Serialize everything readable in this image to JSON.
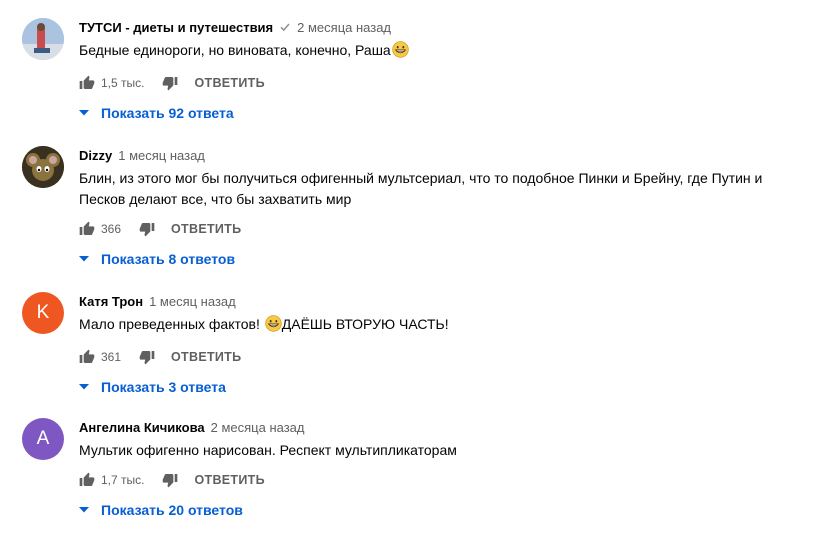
{
  "comments": [
    {
      "author": "ТУТСИ - диеты и путешествия",
      "verified": true,
      "time": "2 месяца назад",
      "text": "Бедные единороги, но виновата, конечно, Раша",
      "emoji": "grinning-face",
      "likes": "1,5 тыс.",
      "reply_label": "ОТВЕТИТЬ",
      "replies_label": "Показать 92 ответа",
      "avatar": {
        "type": "photo",
        "colors": [
          "#4a6fa5",
          "#c94b4b",
          "#e8e8e8"
        ]
      }
    },
    {
      "author": "Dizzy",
      "verified": false,
      "time": "1 месяц назад",
      "text": "Блин, из этого мог бы получиться офигенный мультсериал, что то подобное Пинки и Брейну, где Путин и Песков делают все, что бы захватить мир",
      "likes": "366",
      "reply_label": "ОТВЕТИТЬ",
      "replies_label": "Показать 8 ответов",
      "avatar": {
        "type": "photo",
        "colors": [
          "#5a4a2a",
          "#8b7340",
          "#2b2418"
        ]
      }
    },
    {
      "author": "Катя Трон",
      "verified": false,
      "time": "1 месяц назад",
      "text_before": "Мало преведенных фактов!",
      "text_after": "ДАЁШЬ ВТОРУЮ ЧАСТЬ!",
      "emoji": "grinning-face",
      "likes": "361",
      "reply_label": "ОТВЕТИТЬ",
      "replies_label": "Показать 3 ответа",
      "avatar": {
        "type": "letter",
        "letter": "K",
        "color": "#ef5722"
      }
    },
    {
      "author": "Ангелина Кичикова",
      "verified": false,
      "time": "2 месяца назад",
      "text": "Мультик офигенно нарисован. Респект мультипликаторам",
      "likes": "1,7 тыс.",
      "reply_label": "ОТВЕТИТЬ",
      "replies_label": "Показать 20 ответов",
      "avatar": {
        "type": "letter",
        "letter": "A",
        "color": "#7e57c2"
      }
    }
  ],
  "colors": {
    "link": "#065fd4",
    "meta": "#606060",
    "text": "#030303"
  }
}
